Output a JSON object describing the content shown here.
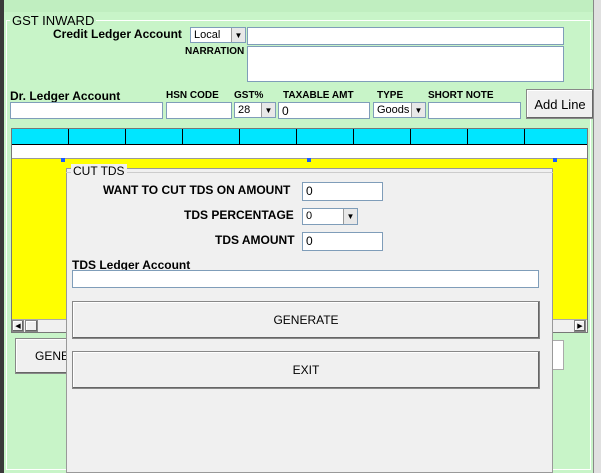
{
  "group_title": "GST INWARD",
  "credit_ledger": {
    "label": "Credit Ledger Account",
    "mode": "Local",
    "value": ""
  },
  "narration": {
    "label": "NARRATION",
    "value": ""
  },
  "line_entry": {
    "dr_label": "Dr.  Ledger Account",
    "hsn_label": "HSN CODE",
    "gst_label": "GST%",
    "taxable_label": "TAXABLE AMT",
    "type_label": "TYPE",
    "note_label": "SHORT NOTE",
    "dr_value": "",
    "hsn_value": "",
    "gst_value": "28",
    "taxable_value": "0",
    "type_value": "Goods",
    "note_value": ""
  },
  "add_line_label": "Add Line",
  "behind_button_label": "GENE",
  "dialog": {
    "title": "CUT TDS",
    "cut_amount_label": "WANT TO CUT TDS ON AMOUNT",
    "cut_amount_value": "0",
    "percent_label": "TDS PERCENTAGE",
    "percent_value": "0",
    "tds_amount_label": "TDS AMOUNT",
    "tds_amount_value": "0",
    "ledger_label": "TDS  Ledger Account",
    "ledger_value": "",
    "generate_label": "GENERATE",
    "exit_label": "EXIT"
  },
  "colors": {
    "form_bg": "#c8f4c8",
    "grid_header": "#00e6ff",
    "grid_body": "#ffff00",
    "dialog_bg": "#f0f0f0"
  }
}
